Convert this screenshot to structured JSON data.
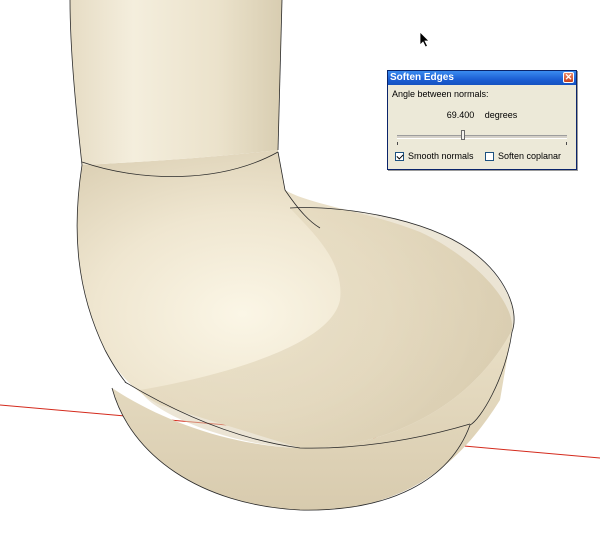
{
  "dialog": {
    "title": "Soften Edges",
    "close_glyph": "✕",
    "angle_label": "Angle between normals:",
    "angle_value": "69.400",
    "angle_unit": "degrees",
    "slider_fraction": 0.385,
    "options": {
      "smooth_normals": {
        "label": "Smooth normals",
        "checked": true
      },
      "soften_coplanar": {
        "label": "Soften coplanar",
        "checked": false
      }
    }
  },
  "scene": {
    "object": "pipe-bend-model",
    "surface_color": "#ece3cf",
    "edge_color": "#2a2a2a",
    "axis_color": "#d42a1c"
  },
  "icons": {
    "cursor": "arrow-cursor-icon",
    "close": "close-icon"
  }
}
